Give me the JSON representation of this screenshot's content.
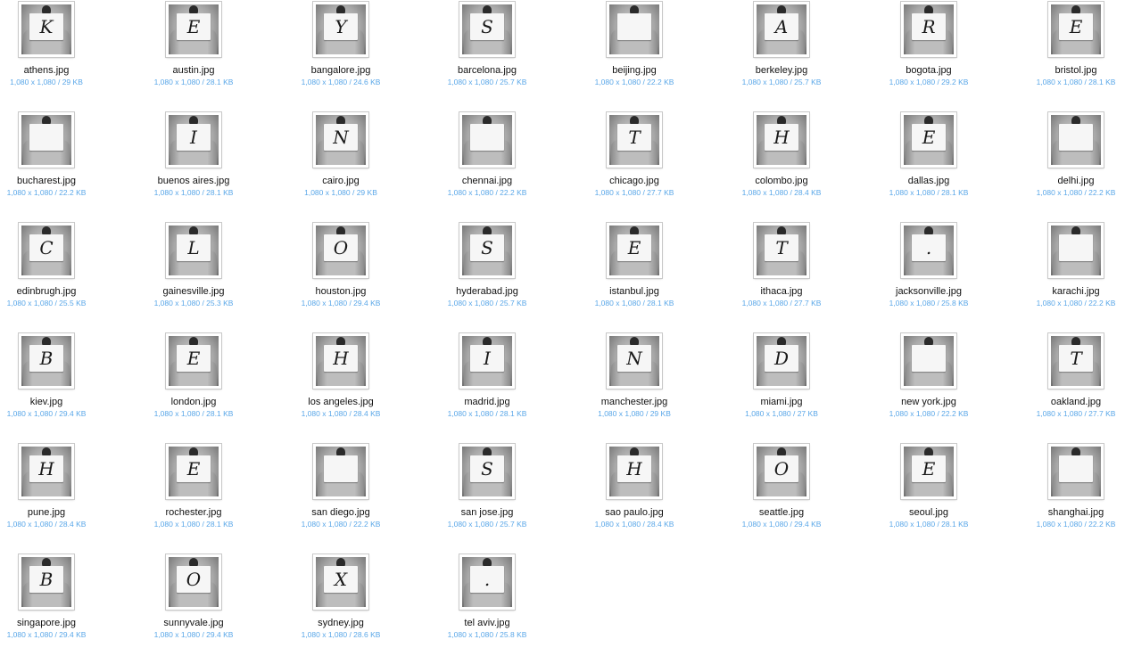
{
  "colors": {
    "meta_text": "#5aa7e8",
    "name_text": "#111111",
    "background": "#ffffff"
  },
  "files": [
    {
      "name": "athens.jpg",
      "meta": "1,080 x 1,080 / 29 KB",
      "letter": "K"
    },
    {
      "name": "austin.jpg",
      "meta": "1,080 x 1,080 / 28.1 KB",
      "letter": "E"
    },
    {
      "name": "bangalore.jpg",
      "meta": "1,080 x 1,080 / 24.6 KB",
      "letter": "Y"
    },
    {
      "name": "barcelona.jpg",
      "meta": "1,080 x 1,080 / 25.7 KB",
      "letter": "S"
    },
    {
      "name": "beijing.jpg",
      "meta": "1,080 x 1,080 / 22.2 KB",
      "letter": ""
    },
    {
      "name": "berkeley.jpg",
      "meta": "1,080 x 1,080 / 25.7 KB",
      "letter": "A"
    },
    {
      "name": "bogota.jpg",
      "meta": "1,080 x 1,080 / 29.2 KB",
      "letter": "R"
    },
    {
      "name": "bristol.jpg",
      "meta": "1,080 x 1,080 / 28.1 KB",
      "letter": "E"
    },
    {
      "name": "bucharest.jpg",
      "meta": "1,080 x 1,080 / 22.2 KB",
      "letter": ""
    },
    {
      "name": "buenos aires.jpg",
      "meta": "1,080 x 1,080 / 28.1 KB",
      "letter": "I"
    },
    {
      "name": "cairo.jpg",
      "meta": "1,080 x 1,080 / 29 KB",
      "letter": "N"
    },
    {
      "name": "chennai.jpg",
      "meta": "1,080 x 1,080 / 22.2 KB",
      "letter": ""
    },
    {
      "name": "chicago.jpg",
      "meta": "1,080 x 1,080 / 27.7 KB",
      "letter": "T"
    },
    {
      "name": "colombo.jpg",
      "meta": "1,080 x 1,080 / 28.4 KB",
      "letter": "H"
    },
    {
      "name": "dallas.jpg",
      "meta": "1,080 x 1,080 / 28.1 KB",
      "letter": "E"
    },
    {
      "name": "delhi.jpg",
      "meta": "1,080 x 1,080 / 22.2 KB",
      "letter": ""
    },
    {
      "name": "edinbrugh.jpg",
      "meta": "1,080 x 1,080 / 25.5 KB",
      "letter": "C"
    },
    {
      "name": "gainesville.jpg",
      "meta": "1,080 x 1,080 / 25.3 KB",
      "letter": "L"
    },
    {
      "name": "houston.jpg",
      "meta": "1,080 x 1,080 / 29.4 KB",
      "letter": "O"
    },
    {
      "name": "hyderabad.jpg",
      "meta": "1,080 x 1,080 / 25.7 KB",
      "letter": "S"
    },
    {
      "name": "istanbul.jpg",
      "meta": "1,080 x 1,080 / 28.1 KB",
      "letter": "E"
    },
    {
      "name": "ithaca.jpg",
      "meta": "1,080 x 1,080 / 27.7 KB",
      "letter": "T"
    },
    {
      "name": "jacksonville.jpg",
      "meta": "1,080 x 1,080 / 25.8 KB",
      "letter": "."
    },
    {
      "name": "karachi.jpg",
      "meta": "1,080 x 1,080 / 22.2 KB",
      "letter": ""
    },
    {
      "name": "kiev.jpg",
      "meta": "1,080 x 1,080 / 29.4 KB",
      "letter": "B"
    },
    {
      "name": "london.jpg",
      "meta": "1,080 x 1,080 / 28.1 KB",
      "letter": "E"
    },
    {
      "name": "los angeles.jpg",
      "meta": "1,080 x 1,080 / 28.4 KB",
      "letter": "H"
    },
    {
      "name": "madrid.jpg",
      "meta": "1,080 x 1,080 / 28.1 KB",
      "letter": "I"
    },
    {
      "name": "manchester.jpg",
      "meta": "1,080 x 1,080 / 29 KB",
      "letter": "N"
    },
    {
      "name": "miami.jpg",
      "meta": "1,080 x 1,080 / 27 KB",
      "letter": "D"
    },
    {
      "name": "new york.jpg",
      "meta": "1,080 x 1,080 / 22.2 KB",
      "letter": ""
    },
    {
      "name": "oakland.jpg",
      "meta": "1,080 x 1,080 / 27.7 KB",
      "letter": "T"
    },
    {
      "name": "pune.jpg",
      "meta": "1,080 x 1,080 / 28.4 KB",
      "letter": "H"
    },
    {
      "name": "rochester.jpg",
      "meta": "1,080 x 1,080 / 28.1 KB",
      "letter": "E"
    },
    {
      "name": "san diego.jpg",
      "meta": "1,080 x 1,080 / 22.2 KB",
      "letter": ""
    },
    {
      "name": "san jose.jpg",
      "meta": "1,080 x 1,080 / 25.7 KB",
      "letter": "S"
    },
    {
      "name": "sao paulo.jpg",
      "meta": "1,080 x 1,080 / 28.4 KB",
      "letter": "H"
    },
    {
      "name": "seattle.jpg",
      "meta": "1,080 x 1,080 / 29.4 KB",
      "letter": "O"
    },
    {
      "name": "seoul.jpg",
      "meta": "1,080 x 1,080 / 28.1 KB",
      "letter": "E"
    },
    {
      "name": "shanghai.jpg",
      "meta": "1,080 x 1,080 / 22.2 KB",
      "letter": ""
    },
    {
      "name": "singapore.jpg",
      "meta": "1,080 x 1,080 / 29.4 KB",
      "letter": "B"
    },
    {
      "name": "sunnyvale.jpg",
      "meta": "1,080 x 1,080 / 29.4 KB",
      "letter": "O"
    },
    {
      "name": "sydney.jpg",
      "meta": "1,080 x 1,080 / 28.6 KB",
      "letter": "X"
    },
    {
      "name": "tel aviv.jpg",
      "meta": "1,080 x 1,080 / 25.8 KB",
      "letter": "."
    }
  ]
}
